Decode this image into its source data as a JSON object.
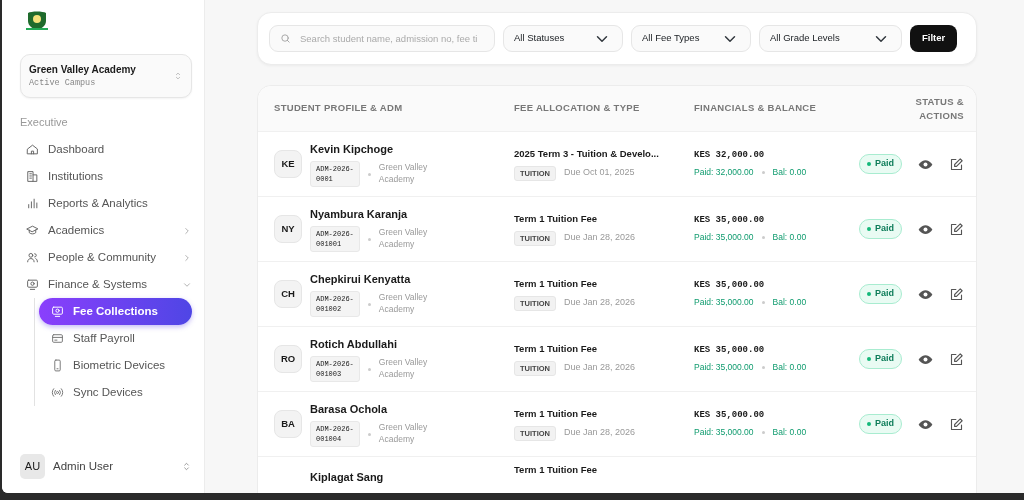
{
  "sidebar": {
    "campus": {
      "name": "Green Valley Academy",
      "subtitle": "Active Campus"
    },
    "section_label": "Executive",
    "items": [
      {
        "kind": "link",
        "label": "Dashboard"
      },
      {
        "kind": "link",
        "label": "Institutions"
      },
      {
        "kind": "link",
        "label": "Reports & Analytics"
      },
      {
        "kind": "group",
        "label": "Academics",
        "expanded": false
      },
      {
        "kind": "group",
        "label": "People & Community",
        "expanded": false
      },
      {
        "kind": "group",
        "label": "Finance & Systems",
        "expanded": true,
        "children": [
          {
            "label": "Fee Collections",
            "selected": true
          },
          {
            "label": "Staff Payroll",
            "selected": false
          },
          {
            "label": "Biometric Devices",
            "selected": false
          },
          {
            "label": "Sync Devices",
            "selected": false
          }
        ]
      }
    ],
    "user": {
      "initials": "AU",
      "name": "Admin User"
    }
  },
  "filters": {
    "search": {
      "placeholder": "Search student name, admission no, fee ti"
    },
    "selects": [
      "All Statuses",
      "All Fee Types",
      "All Grade Levels"
    ],
    "button": "Filter"
  },
  "table": {
    "columns": [
      "STUDENT PROFILE & ADM",
      "FEE ALLOCATION & TYPE",
      "FINANCIALS & BALANCE",
      "STATUS & ACTIONS"
    ],
    "rows": [
      {
        "initials": "KE",
        "name": "Kevin Kipchoge",
        "adm": "ADM-2026-0001",
        "school": "Green Valley Academy",
        "fee_title": "2025 Term 3 - Tuition & Develo...",
        "fee_type": "TUITION",
        "due": "Due Oct 01, 2025",
        "total": "KES 32,000.00",
        "paid": "Paid: 32,000.00",
        "balance": "Bal: 0.00",
        "status": "Paid"
      },
      {
        "initials": "NY",
        "name": "Nyambura Karanja",
        "adm": "ADM-2026-001001",
        "school": "Green Valley Academy",
        "fee_title": "Term 1 Tuition Fee",
        "fee_type": "TUITION",
        "due": "Due Jan 28, 2026",
        "total": "KES 35,000.00",
        "paid": "Paid: 35,000.00",
        "balance": "Bal: 0.00",
        "status": "Paid"
      },
      {
        "initials": "CH",
        "name": "Chepkirui Kenyatta",
        "adm": "ADM-2026-001002",
        "school": "Green Valley Academy",
        "fee_title": "Term 1 Tuition Fee",
        "fee_type": "TUITION",
        "due": "Due Jan 28, 2026",
        "total": "KES 35,000.00",
        "paid": "Paid: 35,000.00",
        "balance": "Bal: 0.00",
        "status": "Paid"
      },
      {
        "initials": "RO",
        "name": "Rotich Abdullahi",
        "adm": "ADM-2026-001003",
        "school": "Green Valley Academy",
        "fee_title": "Term 1 Tuition Fee",
        "fee_type": "TUITION",
        "due": "Due Jan 28, 2026",
        "total": "KES 35,000.00",
        "paid": "Paid: 35,000.00",
        "balance": "Bal: 0.00",
        "status": "Paid"
      },
      {
        "initials": "BA",
        "name": "Barasa Ochola",
        "adm": "ADM-2026-001004",
        "school": "Green Valley Academy",
        "fee_title": "Term 1 Tuition Fee",
        "fee_type": "TUITION",
        "due": "Due Jan 28, 2026",
        "total": "KES 35,000.00",
        "paid": "Paid: 35,000.00",
        "balance": "Bal: 0.00",
        "status": "Paid"
      },
      {
        "name": "Kiplagat Sang",
        "fee_title": "Term 1 Tuition Fee"
      }
    ]
  }
}
